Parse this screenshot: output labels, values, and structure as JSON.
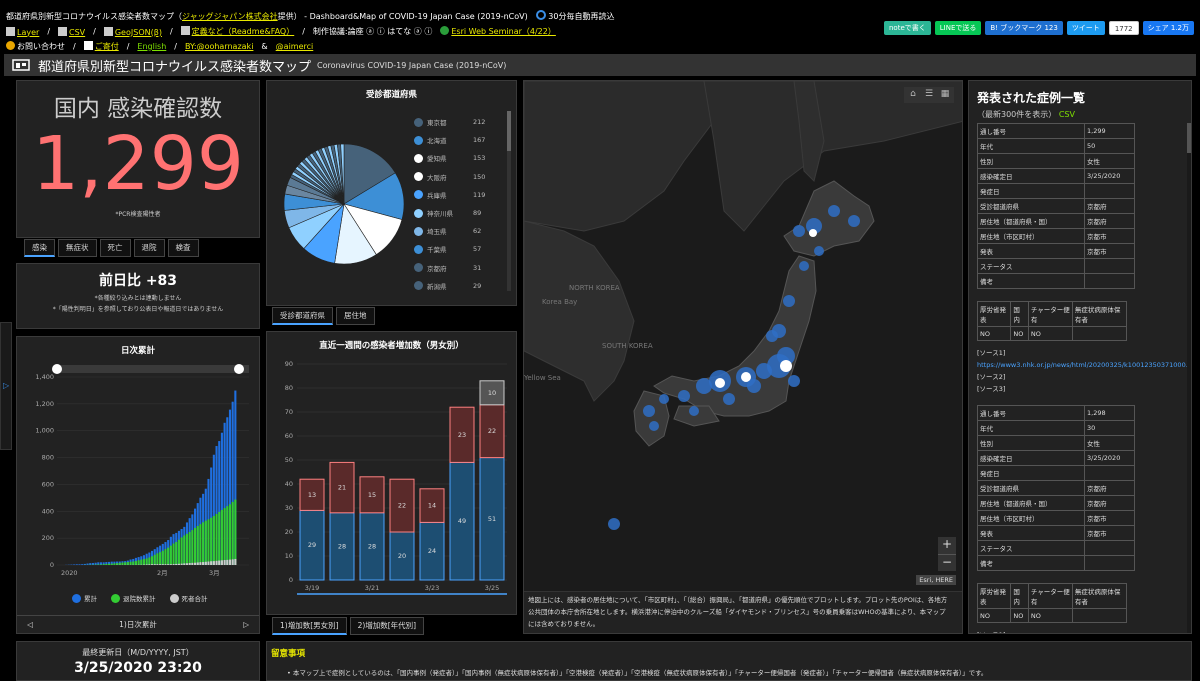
{
  "header": {
    "line1_title": "都道府県別新型コロナウイルス感染者数マップ（",
    "line1_company": "ジャッグジャパン株式会社",
    "line1_suffix": "提供） - Dashboard&Map of COVID-19 Japan Case (2019-nCoV)",
    "auto_reload": "30分毎自動再読込",
    "links": [
      "Layer",
      "CSV",
      "GeoJSON(β)",
      "定義など（Readme&FAQ）",
      "Esri Web Seminar（4/22）"
    ],
    "credit": "制作協議:論座 ⓐ ⓘ はてな ⓐ ⓘ",
    "contact": "お問い合わせ",
    "donate": "ご寄付",
    "english": "English",
    "by": "BY:@ooharnazaki",
    "aimerci": "@aimerci",
    "by_sep": "&"
  },
  "share": {
    "note": "noteで書く",
    "line": "LINEで送る",
    "hatena": "B! ブックマーク 123",
    "tweet": "ツイート",
    "tweet_count": "1772",
    "fb": "シェア 1.2万"
  },
  "titlebar": {
    "title": "都道府県別新型コロナウイルス感染者数マップ",
    "subtitle": "Coronavirus COVID-19 Japan Case (2019-nCoV)"
  },
  "total": {
    "label": "国内 感染確認数",
    "value": "1,299",
    "note": "*PCR検査陽性者"
  },
  "total_tabs": [
    "感染",
    "無症状",
    "死亡",
    "退院",
    "検査"
  ],
  "diff": {
    "label": "前日比 +83",
    "note1": "*各種絞り込みとは連動しません",
    "note2": "*「陽性判明日」を参照しており公表日や報道日ではありません"
  },
  "cumulative": {
    "title": "日次累計",
    "footer": "1)日次累計",
    "legend": [
      "累計",
      "退院数累計",
      "死者合計"
    ],
    "legend_colors": [
      "#1f6fe0",
      "#33cc33",
      "#cccccc"
    ]
  },
  "updated": {
    "label": "最終更新日（M/D/YYYY, JST）",
    "value": "3/25/2020 23:20"
  },
  "pref": {
    "title": "受診都道府県",
    "tabs": [
      "受診都道府県",
      "居住地"
    ],
    "items": [
      {
        "name": "東京都",
        "count": "212",
        "color": "#46627a"
      },
      {
        "name": "北海道",
        "count": "167",
        "color": "#3d8fd6"
      },
      {
        "name": "愛知県",
        "count": "153",
        "color": "#ffffff"
      },
      {
        "name": "大阪府",
        "count": "150",
        "color": "#ffffff"
      },
      {
        "name": "兵庫県",
        "count": "119",
        "color": "#4aa3ff"
      },
      {
        "name": "神奈川県",
        "count": "89",
        "color": "#8fd0ff"
      },
      {
        "name": "埼玉県",
        "count": "62",
        "color": "#7fb7e8"
      },
      {
        "name": "千葉県",
        "count": "57",
        "color": "#3d8fd6"
      },
      {
        "name": "京都府",
        "count": "31",
        "color": "#46627a"
      },
      {
        "name": "新潟県",
        "count": "29",
        "color": "#46627a"
      }
    ]
  },
  "weekly": {
    "title": "直近一週間の感染者増加数（男女別）",
    "tabs": [
      "1)増加数[男女別]",
      "2)増加数[年代別]"
    ]
  },
  "chart_data": [
    {
      "type": "bar",
      "title": "直近一週間の感染者増加数（男女別）",
      "categories": [
        "3/19",
        "3/20",
        "3/21",
        "3/22",
        "3/23",
        "3/24",
        "3/25"
      ],
      "x_tick_labels": [
        "3/19",
        "3/21",
        "3/23",
        "3/25"
      ],
      "ylim": [
        0,
        90
      ],
      "yticks": [
        0,
        10,
        20,
        30,
        40,
        50,
        60,
        70,
        80,
        90
      ],
      "grid": true,
      "stacked": true,
      "series": [
        {
          "values": [
            29,
            28,
            28,
            20,
            24,
            49,
            51
          ],
          "color": "#1d4e72"
        },
        {
          "values": [
            13,
            21,
            15,
            22,
            14,
            23,
            22
          ],
          "color": "#5a2a2a"
        },
        {
          "values": [
            0,
            0,
            0,
            0,
            0,
            0,
            10
          ],
          "color": "#555555"
        }
      ]
    },
    {
      "type": "bar",
      "title": "日次累計",
      "xlabel": "",
      "ylim": [
        0,
        1400
      ],
      "yticks": [
        0,
        200,
        400,
        600,
        800,
        1000,
        1200,
        1400
      ],
      "x_tick_labels": [
        "2020",
        "2月",
        "3月"
      ],
      "grid": true,
      "series": [
        {
          "name": "累計",
          "values": [
            1,
            2,
            3,
            4,
            5,
            5,
            6,
            8,
            11,
            14,
            15,
            17,
            20,
            20,
            20,
            22,
            23,
            25,
            25,
            26,
            26,
            28,
            29,
            33,
            41,
            45,
            53,
            59,
            65,
            73,
            84,
            93,
            105,
            118,
            132,
            144,
            157,
            171,
            186,
            210,
            230,
            239,
            254,
            268,
            284,
            317,
            349,
            377,
            420,
            461,
            501,
            530,
            568,
            641,
            726,
            821,
            886,
            923,
            985,
            1059,
            1100,
            1157,
            1216,
            1299
          ],
          "color": "#1f6fe0"
        },
        {
          "name": "退院数累計",
          "values": [
            0,
            0,
            0,
            0,
            0,
            0,
            0,
            1,
            1,
            2,
            2,
            3,
            4,
            4,
            6,
            8,
            9,
            10,
            12,
            14,
            16,
            18,
            20,
            22,
            24,
            26,
            30,
            35,
            40,
            44,
            49,
            56,
            65,
            76,
            87,
            96,
            106,
            118,
            129,
            144,
            160,
            172,
            188,
            205,
            220,
            232,
            246,
            260,
            276,
            290,
            304,
            318,
            330,
            340,
            352,
            365,
            380,
            395,
            410,
            424,
            438,
            452,
            470,
            487
          ],
          "color": "#33cc33"
        },
        {
          "name": "死者合計",
          "values": [
            0,
            0,
            0,
            0,
            0,
            0,
            0,
            0,
            0,
            0,
            0,
            0,
            0,
            0,
            0,
            0,
            0,
            0,
            0,
            1,
            1,
            1,
            1,
            1,
            1,
            1,
            1,
            2,
            2,
            3,
            4,
            5,
            6,
            6,
            6,
            6,
            6,
            6,
            6,
            6,
            7,
            8,
            9,
            10,
            12,
            13,
            15,
            16,
            17,
            19,
            21,
            22,
            24,
            26,
            28,
            29,
            31,
            33,
            35,
            37,
            38,
            40,
            42,
            45
          ],
          "color": "#cccccc"
        }
      ]
    },
    {
      "type": "pie",
      "title": "受診都道府県",
      "categories": [
        "東京都",
        "北海道",
        "愛知県",
        "大阪府",
        "兵庫県",
        "神奈川県",
        "埼玉県",
        "千葉県",
        "京都府",
        "新潟県"
      ],
      "values": [
        212,
        167,
        153,
        150,
        119,
        89,
        62,
        57,
        31,
        29
      ]
    }
  ],
  "map": {
    "labels": [
      "NORTH KOREA",
      "Korea Bay",
      "SOUTH KOREA",
      "Yellow Sea"
    ],
    "attribution": "Esri, HERE",
    "zoom_in": "+",
    "zoom_out": "−",
    "note": "地図上には、感染者の居住地について、「市区町村」、「（総合）振興局」、「都道府県」の優先順位でプロットします。プロット先のPOIは、各地方公共団体の本庁舎所在地とします。横浜港沖に停泊中のクルーズ船「ダイヤモンド・プリンセス」号の乗員乗客はWHOの基準により、本マップには含めておりません。"
  },
  "cases": {
    "title": "発表された症例一覧",
    "subtitle": "（最新300件を表示）",
    "csv": "CSV",
    "records": [
      {
        "rows": [
          [
            "通し番号",
            "1,299"
          ],
          [
            "年代",
            "50"
          ],
          [
            "性別",
            "女性"
          ],
          [
            "感染確定日",
            "3/25/2020"
          ],
          [
            "発症日",
            ""
          ],
          [
            "受診都道府県",
            "京都府"
          ],
          [
            "居住地（都道府県・国）",
            "京都府"
          ],
          [
            "居住地（市区町村）",
            "京都市"
          ],
          [
            "発表",
            "京都市"
          ],
          [
            "ステータス",
            ""
          ],
          [
            "備考",
            ""
          ]
        ],
        "sub_headers": [
          "厚労省発表",
          "国内",
          "チャーター便有",
          "無症状病原体保有者"
        ],
        "sub_values": [
          "NO",
          "NO",
          "NO",
          ""
        ],
        "src_label": "[ソース1]",
        "src_url": "https://www3.nhk.or.jp/news/html/20200325/k10012350371000.html",
        "src2": "[ソース2]",
        "src3": "[ソース3]"
      },
      {
        "rows": [
          [
            "通し番号",
            "1,298"
          ],
          [
            "年代",
            "30"
          ],
          [
            "性別",
            "女性"
          ],
          [
            "感染確定日",
            "3/25/2020"
          ],
          [
            "発症日",
            ""
          ],
          [
            "受診都道府県",
            "京都府"
          ],
          [
            "居住地（都道府県・国）",
            "京都府"
          ],
          [
            "居住地（市区町村）",
            "京都市"
          ],
          [
            "発表",
            "京都市"
          ],
          [
            "ステータス",
            ""
          ],
          [
            "備考",
            ""
          ]
        ],
        "sub_headers": [
          "厚労省発表",
          "国内",
          "チャーター便有",
          "無症状病原体保有者"
        ],
        "sub_values": [
          "NO",
          "NO",
          "NO",
          ""
        ],
        "src_label": "[ソース1]",
        "src_url": "https://www3.nhk.or.jp/news/html/20200325/k10012350371000.html"
      }
    ]
  },
  "notice": {
    "title": "留意事項",
    "text": "本マップ上で症例としているのは、「国内事例（発症者）」「国内事例（無症状病原体保有者）」「空港検疫（発症者）」「空港検疫（無症状病原体保有者）」「チャーター便帰国者（発症者）」「チャーター便帰国者（無症状病原体保有者）」です。"
  }
}
